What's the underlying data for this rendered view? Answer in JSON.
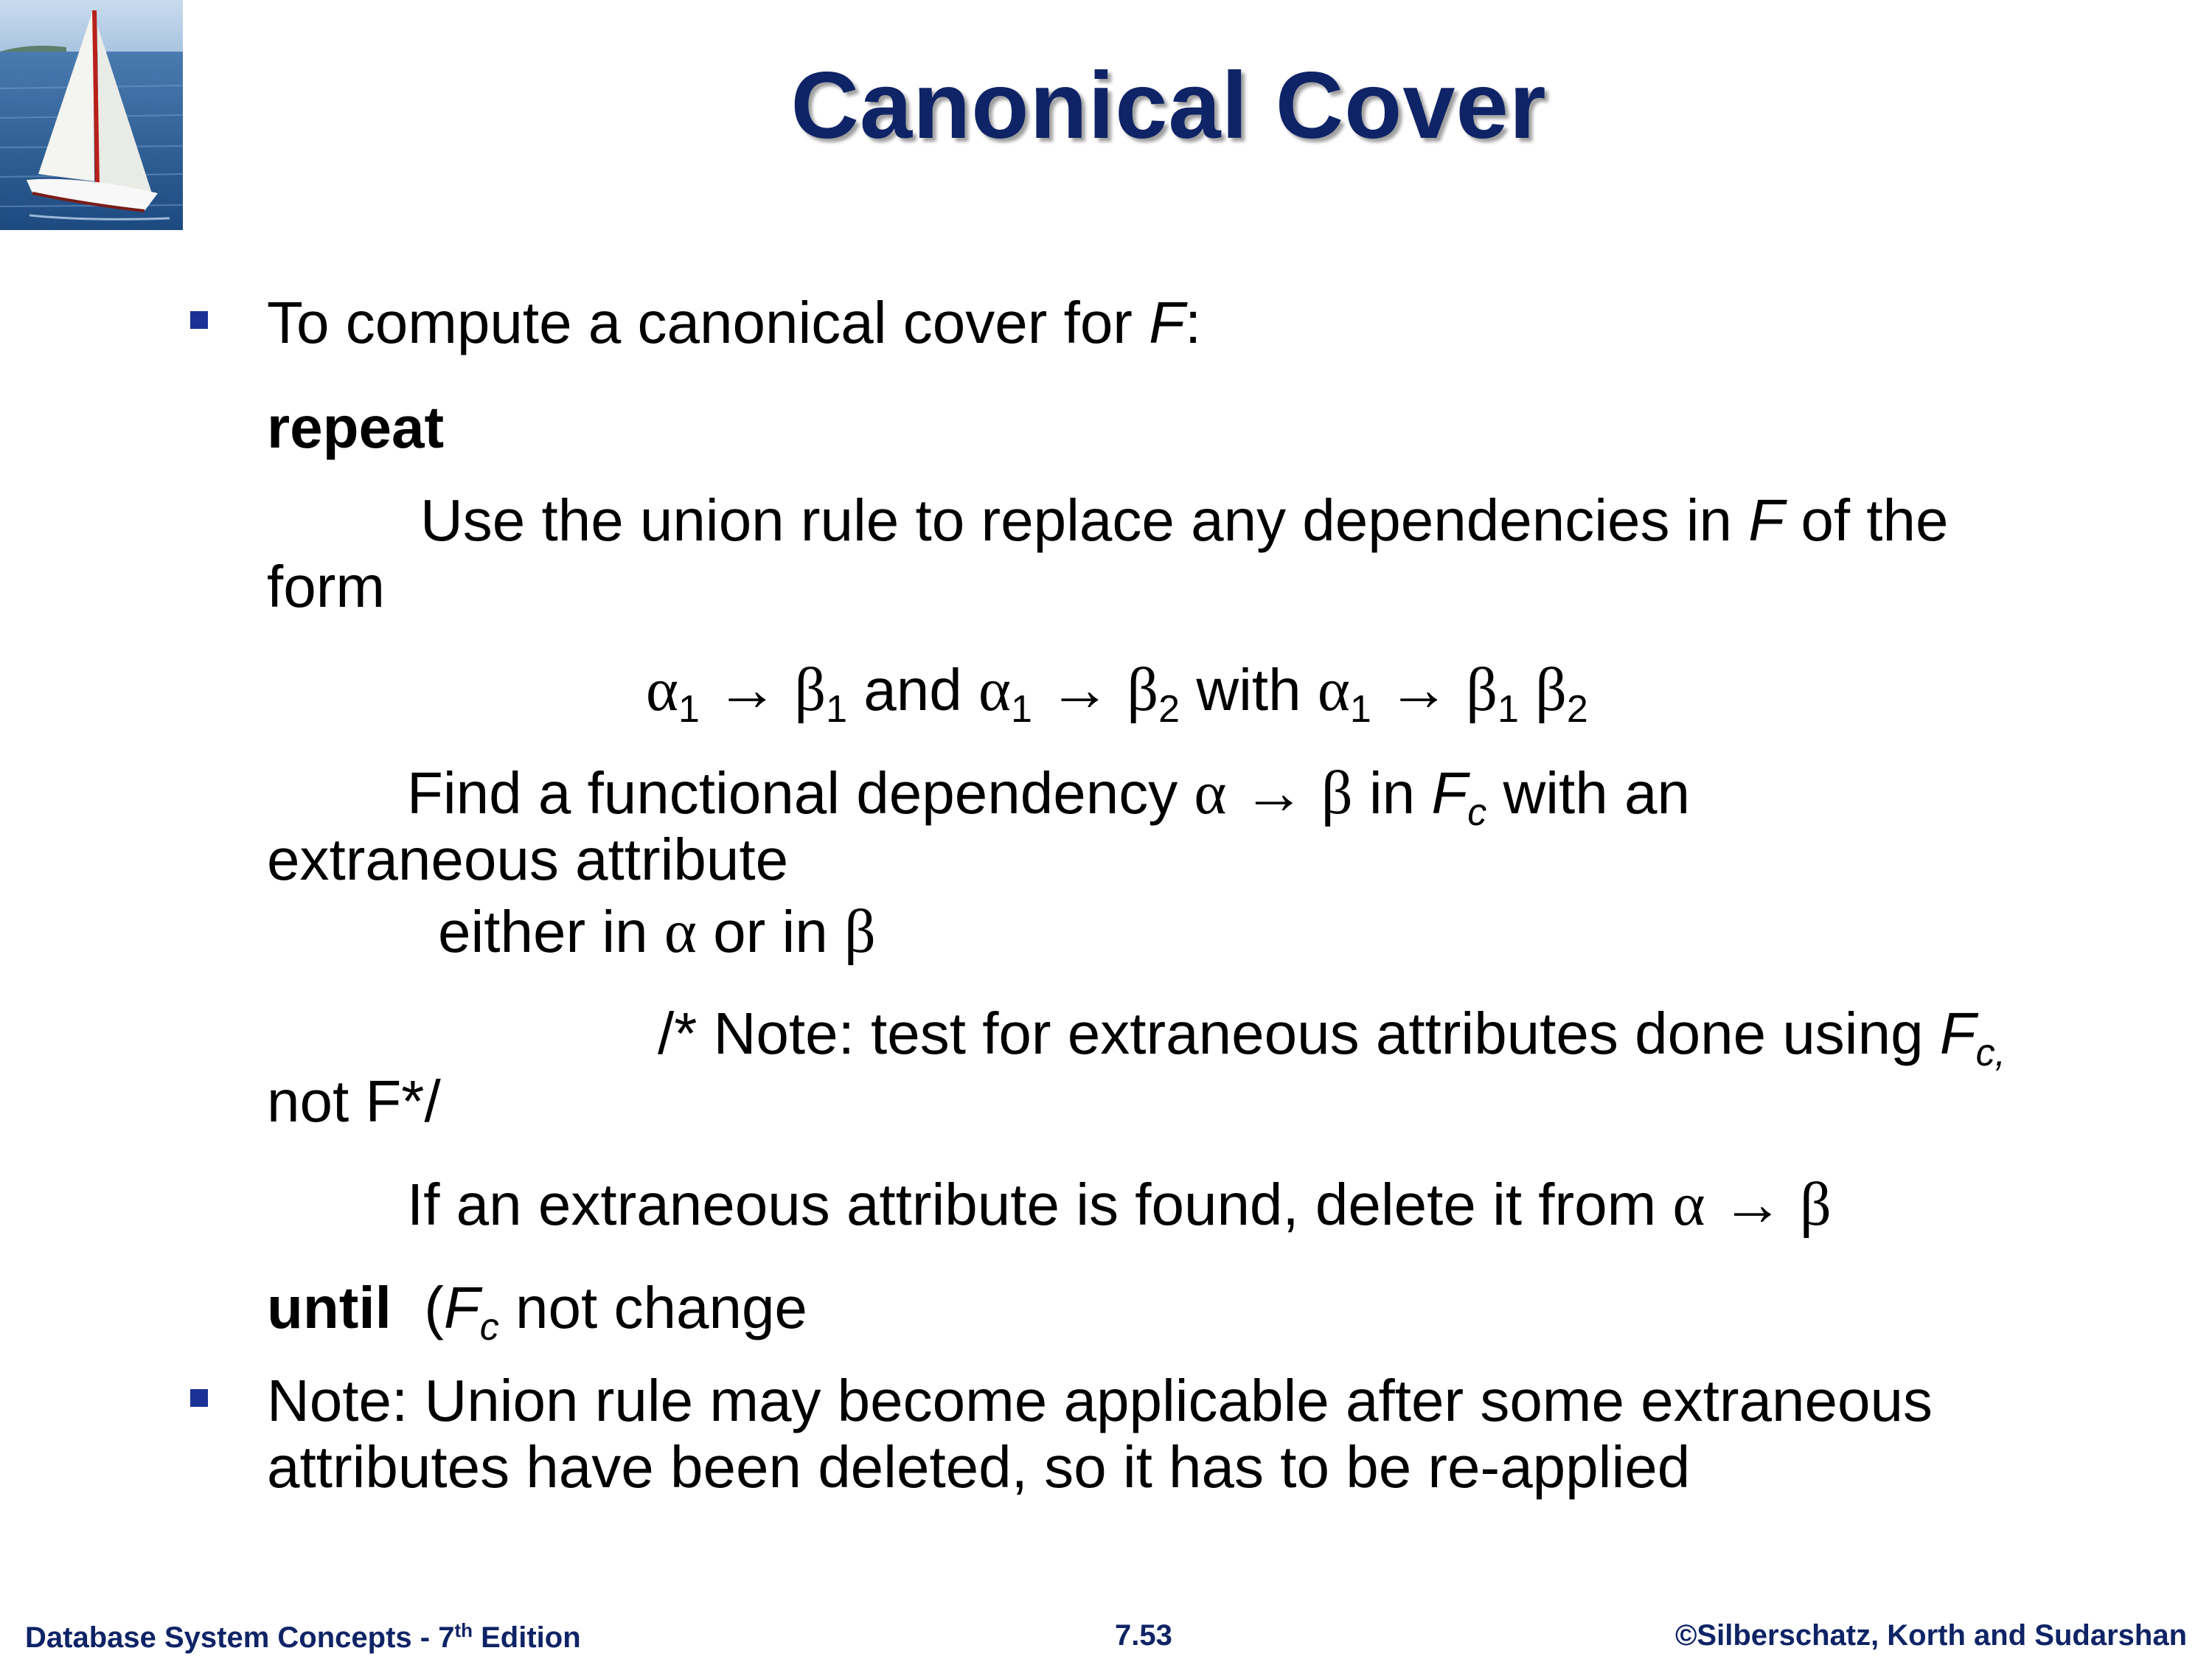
{
  "slide": {
    "title": "Canonical Cover",
    "bullet1": {
      "prefix": "To compute a canonical cover for ",
      "var_F": "F",
      "suffix": ":"
    },
    "repeat_kw": "repeat",
    "union_line": {
      "prefix": "Use the union rule to replace any dependencies in ",
      "var_F": "F",
      "suffix": " of the"
    },
    "form_word": "form",
    "formula": {
      "alpha": "α",
      "beta": "β",
      "arrow": "→",
      "sub1": "1",
      "sub2": "2",
      "and_word": " and ",
      "with_word": " with "
    },
    "find_line": {
      "prefix": "Find a functional dependency ",
      "in_word": "  in ",
      "var_F": "F",
      "sub_c": "c",
      "suffix": " with an"
    },
    "extraneous_word": "extraneous attribute",
    "either_line": {
      "prefix": "either in ",
      "or_word": " or in "
    },
    "note_line": {
      "prefix": "/* Note: test for extraneous attributes done using ",
      "var_F": "F",
      "sub_c": "c,"
    },
    "not_line": "not F*/",
    "delete_line": {
      "prefix": "If an extraneous attribute is found, delete it from "
    },
    "until_line": {
      "keyword": "until",
      "paren": "  (",
      "var_F": "F",
      "sub_c": "c",
      "suffix": " not change"
    },
    "bullet2": {
      "line1": "Note: Union rule may become applicable after some extraneous",
      "line2": "attributes have been deleted, so it has to be re-applied"
    }
  },
  "footer": {
    "left_prefix": "Database System Concepts - 7",
    "left_sup": "th",
    "left_suffix": " Edition",
    "center": "7.53",
    "right": "©Silberschatz, Korth and Sudarshan"
  },
  "colors": {
    "title": "#0f2466",
    "bullet": "#1a3295",
    "footer": "#0f2466"
  }
}
